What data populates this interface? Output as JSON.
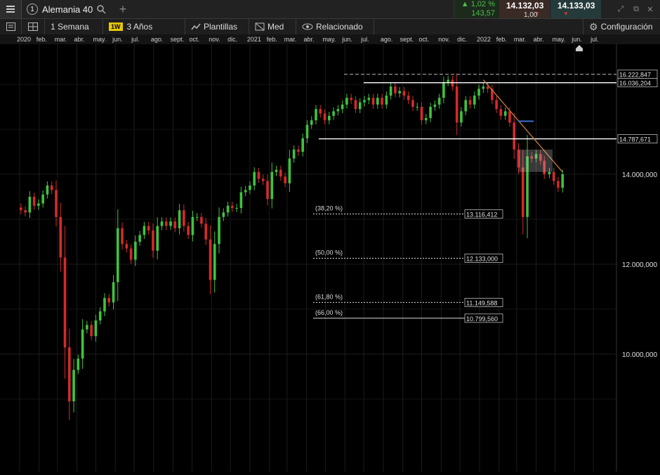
{
  "header": {
    "tab_number": "1",
    "instrument": "Alemania 40",
    "change_pct": "1,02 %",
    "change_abs": "143,57",
    "sell_price": "14.132,03",
    "spread": "1,00",
    "buy_price": "14.133,03"
  },
  "toolbar": {
    "interval_label": "1 Semana",
    "interval_badge": "1W",
    "range_label": "3 Años",
    "templates_label": "Plantillas",
    "price_type_label": "Med",
    "related_label": "Relacionado",
    "settings_label": "Configuración"
  },
  "colors": {
    "up": "#3ec43e",
    "down": "#d42a2a",
    "background": "#000000",
    "trendline": "#c87a3a"
  },
  "icons": [
    "menu-icon",
    "search-icon",
    "plus-icon",
    "layout-icon",
    "grid-icon",
    "eye-icon",
    "gear-icon",
    "expand-icon",
    "popout-icon",
    "close-icon"
  ],
  "chart_data": {
    "type": "candlestick",
    "timeframe": "1W",
    "x_tick_labels": [
      "2020",
      "feb.",
      "mar.",
      "abr.",
      "may.",
      "jun.",
      "jul.",
      "ago.",
      "sept.",
      "oct.",
      "nov.",
      "dic.",
      "2021",
      "feb.",
      "mar.",
      "abr.",
      "may.",
      "jun.",
      "jul.",
      "ago.",
      "sept.",
      "oct.",
      "nov.",
      "dic.",
      "2022",
      "feb.",
      "mar.",
      "abr.",
      "may.",
      "jun.",
      "jul."
    ],
    "y_tick_labels": [
      "14.000,000",
      "12.000,000",
      "10.000,000"
    ],
    "ylim": [
      8450,
      15900
    ],
    "x": [
      "2020-01-03",
      "2020-01-10",
      "2020-01-17",
      "2020-01-24",
      "2020-01-31",
      "2020-02-07",
      "2020-02-14",
      "2020-02-21",
      "2020-02-28",
      "2020-03-06",
      "2020-03-13",
      "2020-03-20",
      "2020-03-27",
      "2020-04-03",
      "2020-04-10",
      "2020-04-17",
      "2020-04-24",
      "2020-05-01",
      "2020-05-08",
      "2020-05-15",
      "2020-05-22",
      "2020-05-29",
      "2020-06-05",
      "2020-06-12",
      "2020-06-19",
      "2020-06-26",
      "2020-07-03",
      "2020-07-10",
      "2020-07-17",
      "2020-07-24",
      "2020-07-31",
      "2020-08-07",
      "2020-08-14",
      "2020-08-21",
      "2020-08-28",
      "2020-09-04",
      "2020-09-11",
      "2020-09-18",
      "2020-09-25",
      "2020-10-02",
      "2020-10-09",
      "2020-10-16",
      "2020-10-23",
      "2020-10-30",
      "2020-11-06",
      "2020-11-13",
      "2020-11-20",
      "2020-11-27",
      "2020-12-04",
      "2020-12-11",
      "2020-12-18",
      "2020-12-25",
      "2021-01-01",
      "2021-01-08",
      "2021-01-15",
      "2021-01-22",
      "2021-01-29",
      "2021-02-05",
      "2021-02-12",
      "2021-02-19",
      "2021-02-26",
      "2021-03-05",
      "2021-03-12",
      "2021-03-19",
      "2021-03-26",
      "2021-04-02",
      "2021-04-09",
      "2021-04-16",
      "2021-04-23",
      "2021-04-30",
      "2021-05-07",
      "2021-05-14",
      "2021-05-21",
      "2021-05-28",
      "2021-06-04",
      "2021-06-11",
      "2021-06-18",
      "2021-06-25",
      "2021-07-02",
      "2021-07-09",
      "2021-07-16",
      "2021-07-23",
      "2021-07-30",
      "2021-08-06",
      "2021-08-13",
      "2021-08-20",
      "2021-08-27",
      "2021-09-03",
      "2021-09-10",
      "2021-09-17",
      "2021-09-24",
      "2021-10-01",
      "2021-10-08",
      "2021-10-15",
      "2021-10-22",
      "2021-10-29",
      "2021-11-05",
      "2021-11-12",
      "2021-11-19",
      "2021-11-26",
      "2021-12-03",
      "2021-12-10",
      "2021-12-17",
      "2021-12-24",
      "2021-12-31",
      "2022-01-07",
      "2022-01-14",
      "2022-01-21",
      "2022-01-28",
      "2022-02-04",
      "2022-02-11",
      "2022-02-18",
      "2022-02-25",
      "2022-03-04",
      "2022-03-11",
      "2022-03-18",
      "2022-03-25",
      "2022-04-01",
      "2022-04-08",
      "2022-04-14",
      "2022-04-22",
      "2022-04-29",
      "2022-05-06",
      "2022-05-13"
    ],
    "close": [
      13200,
      13150,
      13500,
      13300,
      13350,
      13550,
      13750,
      13650,
      13050,
      12150,
      10150,
      8950,
      9650,
      9900,
      10550,
      10650,
      10400,
      10750,
      10950,
      11250,
      11150,
      11600,
      12800,
      12450,
      12350,
      12100,
      12500,
      12650,
      12850,
      12750,
      12300,
      12850,
      12950,
      12850,
      12950,
      12800,
      13200,
      12850,
      12650,
      13050,
      13050,
      12900,
      12550,
      11650,
      12450,
      13050,
      13150,
      13300,
      13250,
      13250,
      13600,
      13650,
      13750,
      14050,
      13900,
      13850,
      13450,
      14050,
      14100,
      13950,
      13800,
      14350,
      14550,
      14500,
      14800,
      15100,
      15200,
      15450,
      15350,
      15200,
      15300,
      15400,
      15450,
      15550,
      15700,
      15650,
      15450,
      15600,
      15650,
      15700,
      15550,
      15700,
      15550,
      15750,
      15950,
      15800,
      15850,
      15750,
      15650,
      15500,
      15500,
      15200,
      15250,
      15500,
      15550,
      15700,
      16050,
      16100,
      15950,
      15150,
      15400,
      15650,
      15550,
      15750,
      15900,
      15950,
      15900,
      15650,
      15450,
      15300,
      15400,
      15150,
      14550,
      14150,
      13050,
      14400,
      14350,
      14450,
      14300,
      14000,
      14050,
      13850,
      13700,
      14000
    ]
  },
  "overlays": {
    "horizontal_levels": [
      {
        "label": "16.222,847",
        "price": 16222.847,
        "style": "dashed"
      },
      {
        "label": "16.036,204",
        "price": 16036.204,
        "style": "solid"
      },
      {
        "label": "14.787,671",
        "price": 14787.671,
        "style": "solid"
      }
    ],
    "fibonacci": [
      {
        "ratio": "(38,20 %)",
        "label": "13.116,412",
        "price": 13116.412,
        "style": "dotted"
      },
      {
        "ratio": "(50,00 %)",
        "label": "12.133,000",
        "price": 12133.0,
        "style": "dotted"
      },
      {
        "ratio": "(61,80 %)",
        "label": "11.149,588",
        "price": 11149.588,
        "style": "dotted"
      },
      {
        "ratio": "(66,00 %)",
        "label": "10.799,560",
        "price": 10799.56,
        "style": "solid"
      }
    ],
    "trendline": {
      "start": {
        "date": "2022-01-07",
        "price": 16100
      },
      "end": {
        "date": "2022-05-13",
        "price": 14050
      }
    }
  }
}
